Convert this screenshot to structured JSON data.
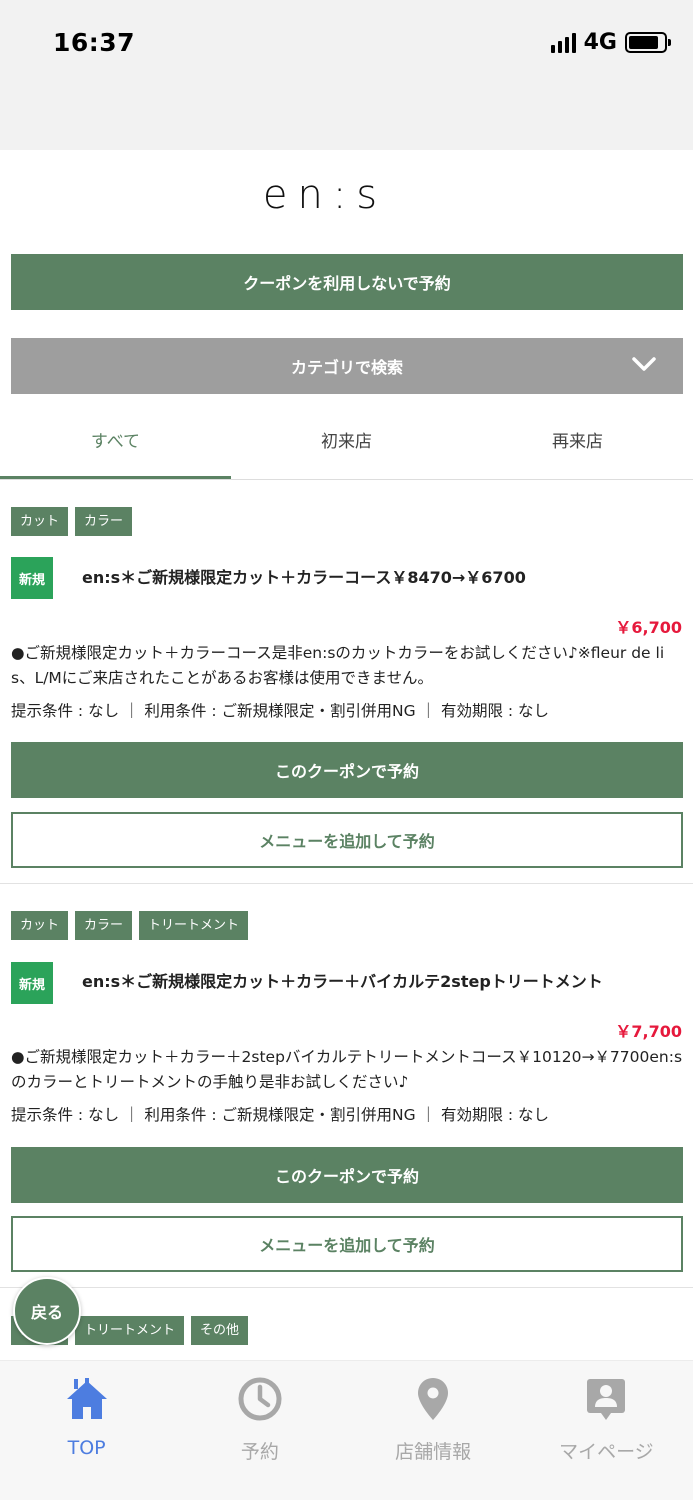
{
  "status": {
    "time": "16:37",
    "network": "4G",
    "battery_level": 0.85
  },
  "logo": "en:s",
  "top_actions": {
    "no_coupon_label": "クーポンを利用しないで予約",
    "category_search_label": "カテゴリで検索"
  },
  "tabs": [
    {
      "label": "すべて",
      "active": true
    },
    {
      "label": "初来店",
      "active": false
    },
    {
      "label": "再来店",
      "active": false
    }
  ],
  "coupons": [
    {
      "tags": [
        "カット",
        "カラー"
      ],
      "badge": "新規",
      "title": "en:s＊ご新規様限定カット＋カラーコース￥8470→￥6700",
      "price": "￥6,700",
      "description": "●ご新規様限定カット＋カラーコース是非en:sのカットカラーをお試しください♪※fleur de lis、L/Mにご来店されたことがあるお客様は使用できません。",
      "conditions": "提示条件 : なし ｜ 利用条件 : ご新規様限定・割引併用NG ｜ 有効期限 : なし",
      "reserve_label": "このクーポンで予約",
      "add_menu_label": "メニューを追加して予約"
    },
    {
      "tags": [
        "カット",
        "カラー",
        "トリートメント"
      ],
      "badge": "新規",
      "title": "en:s＊ご新規様限定カット＋カラー＋バイカルテ2stepトリートメント",
      "price": "￥7,700",
      "description": "●ご新規様限定カット＋カラー＋2stepバイカルテトリートメントコース￥10120→￥7700en:sのカラーとトリートメントの手触り是非お試しください♪",
      "conditions": "提示条件 : なし ｜ 利用条件 : ご新規様限定・割引併用NG ｜ 有効期限 : なし",
      "reserve_label": "このクーポンで予約",
      "add_menu_label": "メニューを追加して予約"
    },
    {
      "tags": [
        "カット",
        "トリートメント",
        "その他"
      ]
    }
  ],
  "back_label": "戻る",
  "bottom_nav": [
    {
      "label": "TOP",
      "icon": "home-icon",
      "active": true
    },
    {
      "label": "予約",
      "icon": "clock-icon",
      "active": false
    },
    {
      "label": "店舗情報",
      "icon": "map-pin-icon",
      "active": false
    },
    {
      "label": "マイページ",
      "icon": "user-card-icon",
      "active": false
    }
  ],
  "colors": {
    "primary": "#5b8263",
    "gray_button": "#9e9e9e",
    "new_badge": "#2ba35a",
    "price": "#e6193c",
    "nav_active": "#4d7de0",
    "nav_inactive": "#a8a8a8"
  }
}
